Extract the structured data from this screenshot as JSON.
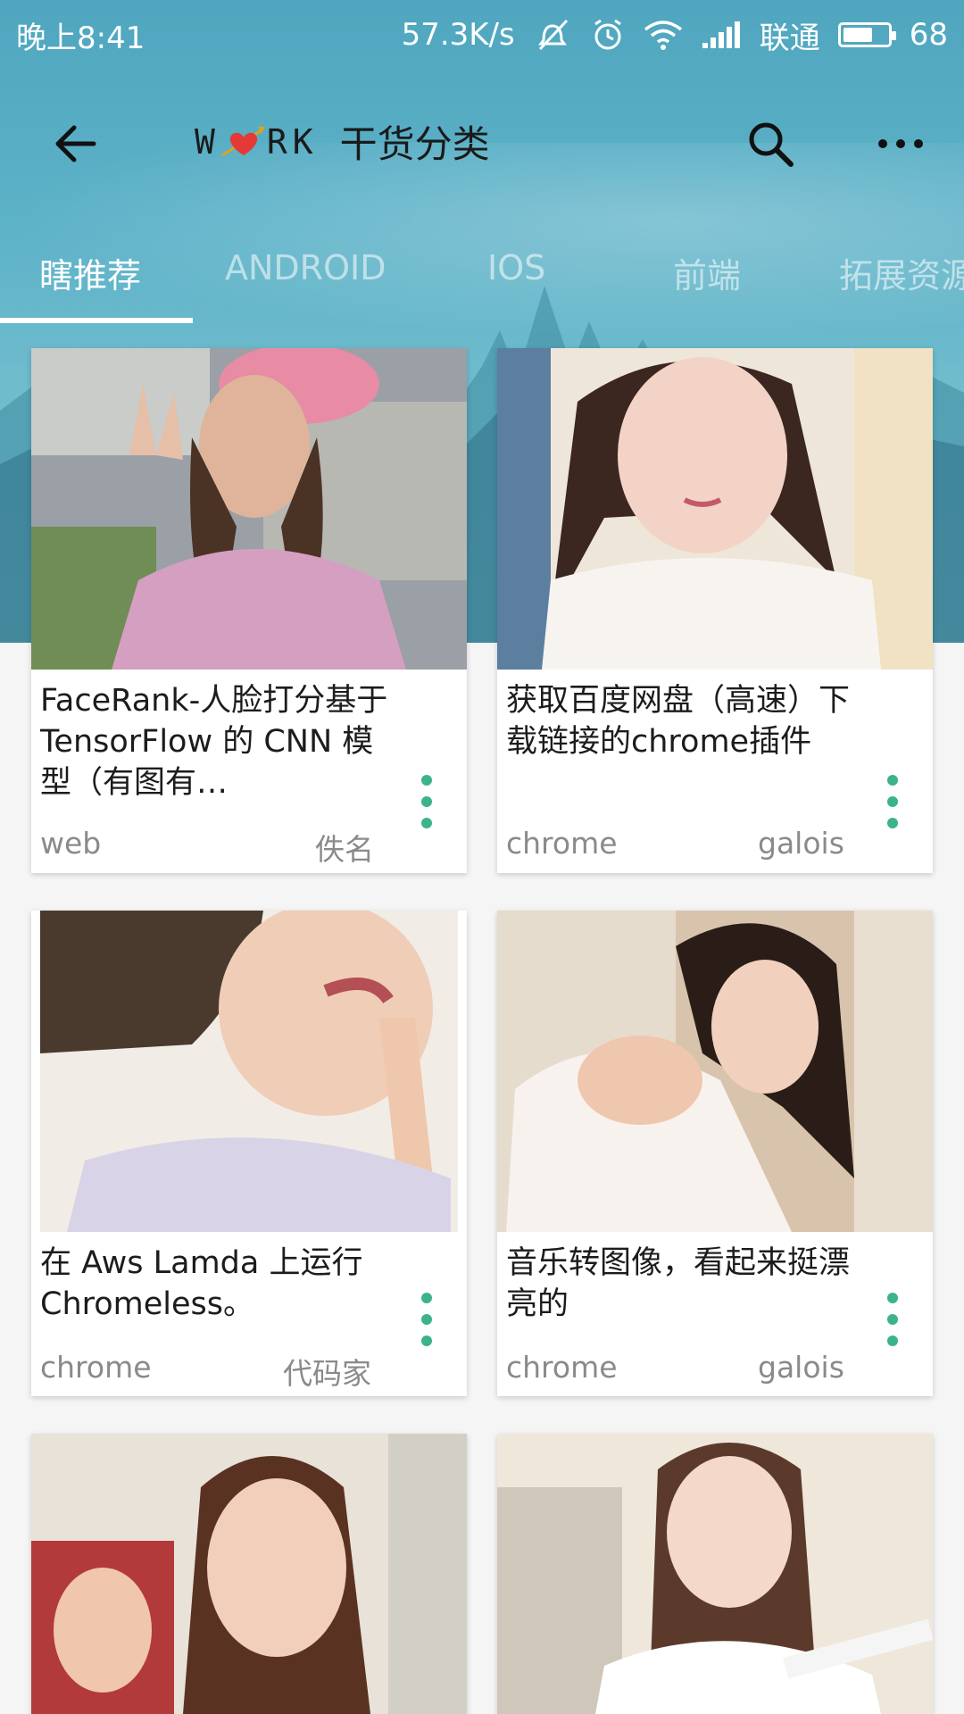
{
  "status_bar": {
    "time": "晚上8:41",
    "speed": "57.3K/s",
    "carrier": "联通",
    "battery": "68",
    "battery_level": 0.68
  },
  "toolbar": {
    "logo_left": "W",
    "logo_right": "RK",
    "title": "干货分类",
    "icons": [
      "back-arrow-icon",
      "search-icon",
      "more-dots-icon"
    ]
  },
  "tabs": [
    {
      "label": "瞎推荐",
      "active": true
    },
    {
      "label": "ANDROID",
      "active": false
    },
    {
      "label": "IOS",
      "active": false
    },
    {
      "label": "前端",
      "active": false
    },
    {
      "label": "拓展资源",
      "active": false
    }
  ],
  "cards": [
    {
      "title": "FaceRank-人脸打分基于 TensorFlow 的 CNN 模型（有图有…",
      "tag": "web",
      "author": "佚名"
    },
    {
      "title": "获取百度网盘（高速）下载链接的chrome插件",
      "tag": "chrome",
      "author": "galois"
    },
    {
      "title": "在 Aws Lamda 上运行 Chromeless。",
      "tag": "chrome",
      "author": "代码家"
    },
    {
      "title": "音乐转图像，看起来挺漂亮的",
      "tag": "chrome",
      "author": "galois"
    },
    {
      "title": "",
      "tag": "",
      "author": ""
    },
    {
      "title": "",
      "tag": "",
      "author": ""
    }
  ],
  "colors": {
    "header": "#5db2c8",
    "accent_menu": "#3cb38b",
    "tab_active": "#ffffff",
    "text_secondary": "#8a8a8a"
  }
}
